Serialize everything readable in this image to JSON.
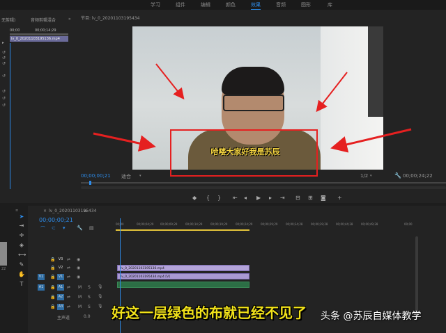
{
  "workspace_tabs": [
    {
      "label": "学习",
      "active": false
    },
    {
      "label": "组件",
      "active": false
    },
    {
      "label": "编辑",
      "active": false
    },
    {
      "label": "颜色",
      "active": false
    },
    {
      "label": "效果",
      "active": true
    },
    {
      "label": "音频",
      "active": false
    },
    {
      "label": "图形",
      "active": false
    },
    {
      "label": "库",
      "active": false
    }
  ],
  "left_panel": {
    "tab1": "无剪辑)",
    "tab2": "音频剪辑混合",
    "time_start": "00;00",
    "time_end": "00;00;14;29",
    "clip_name": "lv_0_20201103195136.mp4"
  },
  "monitor": {
    "title": "节目: lv_0_20201103195434",
    "subtitle": "哈喽大家好我是苏辰",
    "timecode_current": "00;00;00;21",
    "fit_label": "适合",
    "resolution": "1/2",
    "timecode_duration": "00;00;24;22"
  },
  "timeline": {
    "sequence_name": "lv_0_20201103195434",
    "timecode": "00;00;00;21",
    "ruler_ticks": [
      "00;00",
      "00;00;04;29",
      "00;00;09;29",
      "00;00;14;29",
      "00;00;19;29",
      "00;00;24;29",
      "00;00;29;29",
      "00;00;34;28",
      "00;00;39;28",
      "00;00;44;28",
      "00;00;49;28",
      "00;00"
    ],
    "tracks": [
      {
        "label": "V3",
        "source": ""
      },
      {
        "label": "V2",
        "source": ""
      },
      {
        "label": "V1",
        "source": "V1"
      },
      {
        "label": "A1",
        "source": "A1"
      },
      {
        "label": "A2",
        "source": ""
      },
      {
        "label": "A3",
        "source": ""
      }
    ],
    "master_label": "主声道",
    "master_value": "0.0",
    "clip_v2": "lv_0_20201103195136.mp4",
    "clip_v1": "lv_0_20201103195434.mp4 [V]"
  },
  "overlay": {
    "caption": "好这一层绿色的布就已经不见了",
    "watermark": "头条 @苏辰自媒体教学"
  },
  "colors": {
    "accent": "#2d8ceb",
    "annotation_red": "#e52020",
    "caption_yellow": "#f2e21a"
  }
}
